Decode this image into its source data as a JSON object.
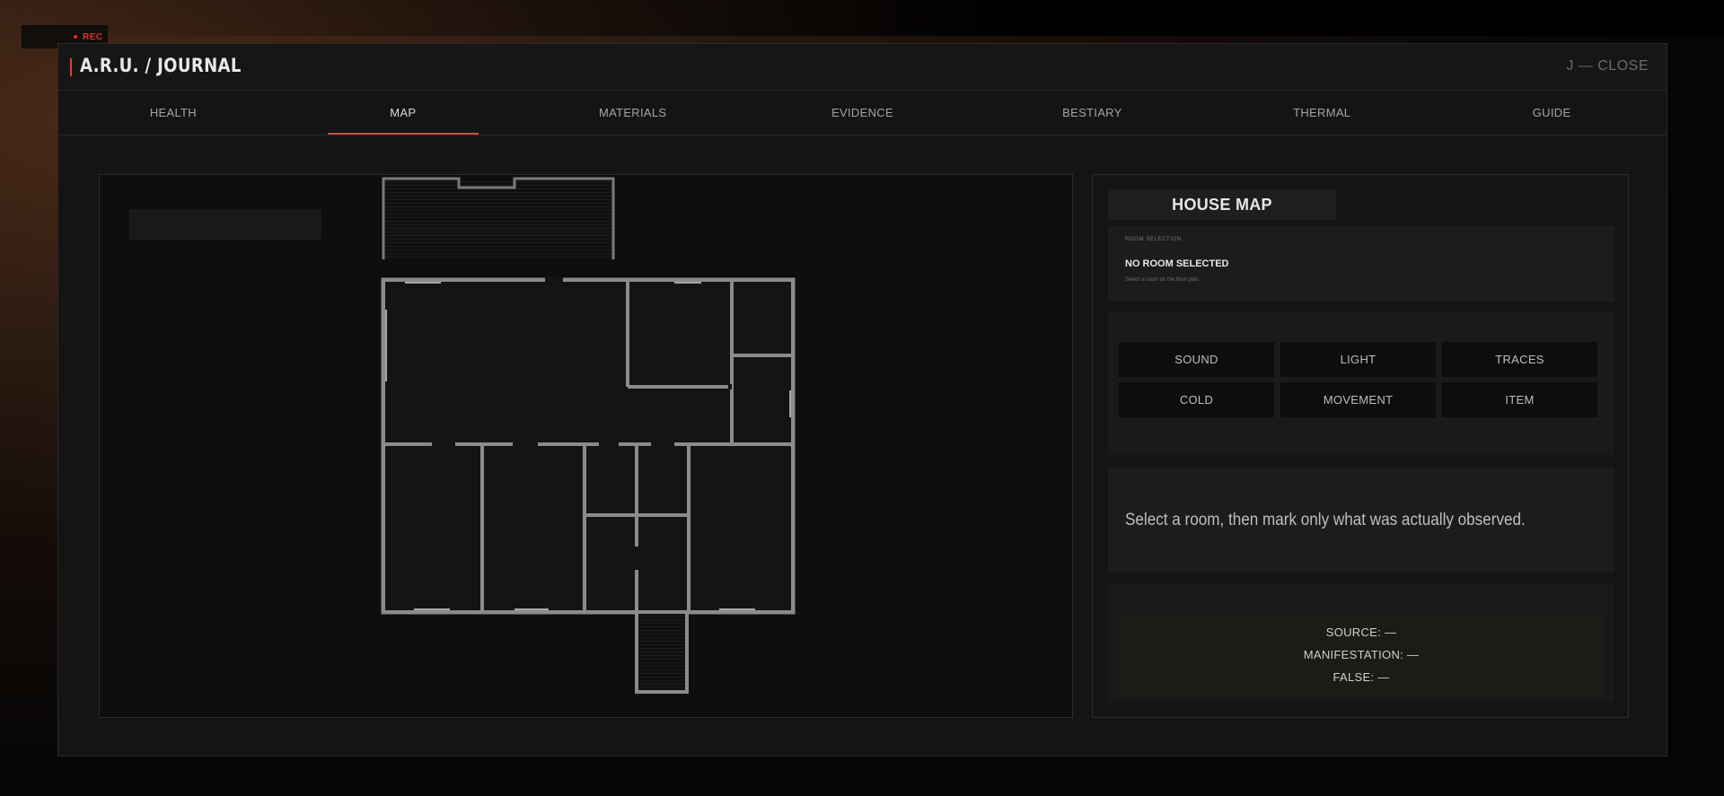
{
  "overlay": {
    "rec_label": "REC"
  },
  "journal": {
    "title": "A.R.U. / JOURNAL",
    "close_label": "J — CLOSE",
    "accent_color": "#d9433a"
  },
  "tabs": [
    {
      "label": "HEALTH",
      "active": false
    },
    {
      "label": "MAP",
      "active": true
    },
    {
      "label": "MATERIALS",
      "active": false
    },
    {
      "label": "EVIDENCE",
      "active": false
    },
    {
      "label": "BESTIARY",
      "active": false
    },
    {
      "label": "THERMAL",
      "active": false
    },
    {
      "label": "GUIDE",
      "active": false
    }
  ],
  "side": {
    "title": "HOUSE MAP",
    "room_selection": {
      "kicker": "ROOM SELECTION",
      "value": "NO ROOM SELECTED",
      "hint": "Select a room on the floor plan."
    },
    "marks": [
      "SOUND",
      "LIGHT",
      "TRACES",
      "COLD",
      "MOVEMENT",
      "ITEM"
    ],
    "note": "Select a room, then mark only what was actually observed.",
    "summary": {
      "source": "SOURCE: —",
      "manifestation": "MANIFESTATION: —",
      "false": "FALSE: —"
    }
  }
}
